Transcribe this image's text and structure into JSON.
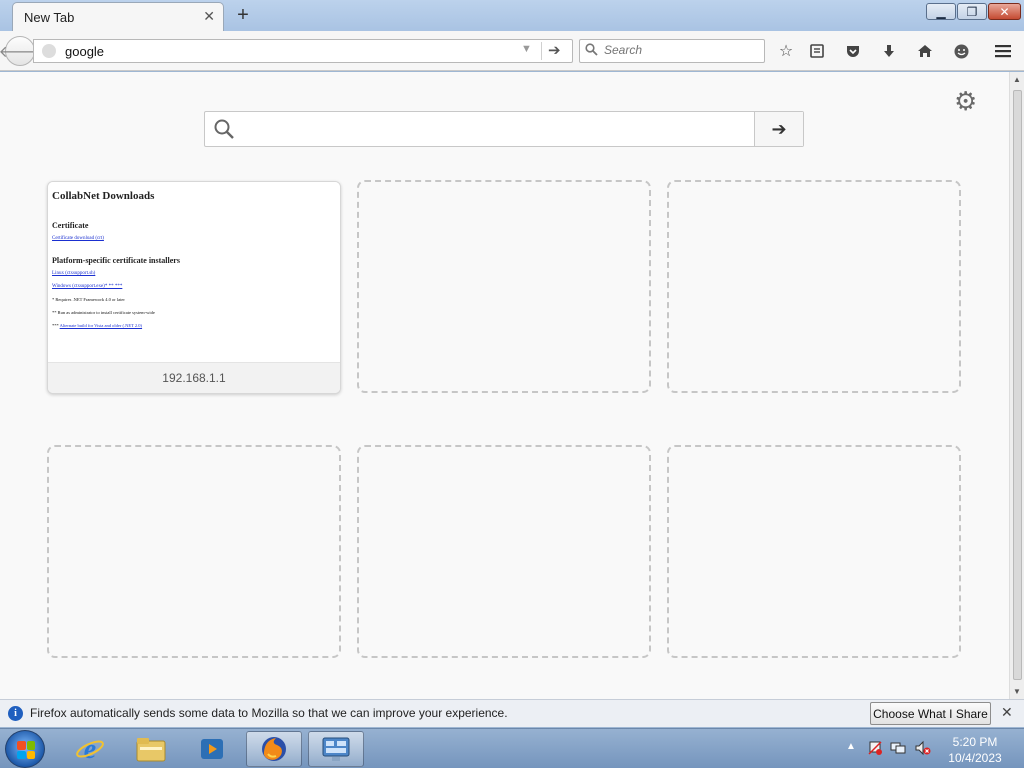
{
  "browser": {
    "tab": {
      "title": "New Tab"
    },
    "urlbar": {
      "value": "google",
      "placeholder": ""
    },
    "searchbar": {
      "placeholder": "Search"
    }
  },
  "newtab": {
    "search": {
      "placeholder": ""
    },
    "tiles": [
      {
        "caption": "192.168.1.1",
        "thumbnail": {
          "heading": "CollabNet Downloads",
          "section1": "Certificate",
          "link1": "Certificate download (crt)",
          "section2": "Platform-specific certificate installers",
          "link2": "Linux (ctxsupport.sh)",
          "link3": "Windows (ctxsupport.exe)* ** ***",
          "note1": "* Requires .NET Framework 4.0 or later",
          "note2": "** Run as administrator to install certificate system-wide",
          "note3_prefix": "***",
          "note3_link": "Alternate build for Vista and older (.NET 2.0)"
        }
      },
      {
        "caption": ""
      },
      {
        "caption": ""
      },
      {
        "caption": ""
      },
      {
        "caption": ""
      },
      {
        "caption": ""
      }
    ]
  },
  "notification": {
    "message": "Firefox automatically sends some data to Mozilla so that we can improve your experience.",
    "button": "Choose What I Share"
  },
  "taskbar": {
    "clock": {
      "time": "5:20 PM",
      "date": "10/4/2023"
    },
    "apps": [
      "internet-explorer",
      "file-explorer",
      "media-player",
      "firefox",
      "control-panel"
    ]
  },
  "colors": {
    "notify_info": "#1f5fbf",
    "link": "#1a2fd0",
    "taskbar": "#7595bd"
  }
}
